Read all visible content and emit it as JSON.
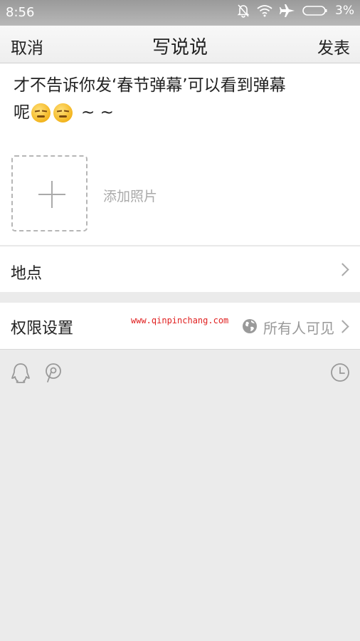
{
  "status_bar": {
    "time": "8:56",
    "battery_percent": "3%",
    "icons": [
      "mute-bell-icon",
      "wifi-icon",
      "airplane-icon",
      "battery-icon"
    ]
  },
  "title_bar": {
    "cancel_label": "取消",
    "title": "写说说",
    "publish_label": "发表"
  },
  "composer": {
    "text_line1": "才不告诉你发‘春节弹幕’可以看到弹幕",
    "text_line2_prefix": "呢",
    "text_line2_suffix": "~ ~",
    "emojis": [
      "smirk-emoji",
      "smirk-emoji"
    ],
    "add_photo_label": "添加照片"
  },
  "location_row": {
    "label": "地点"
  },
  "permission_row": {
    "label": "权限设置",
    "watermark": "www.qinpinchang.com",
    "value": "所有人可见"
  },
  "toolbar": {
    "icons": [
      "qq-icon",
      "mention-icon",
      "clock-icon"
    ]
  },
  "colors": {
    "status_bar_bg": "#b0b0b0",
    "page_bg": "#ebebeb",
    "watermark": "#e02020"
  }
}
